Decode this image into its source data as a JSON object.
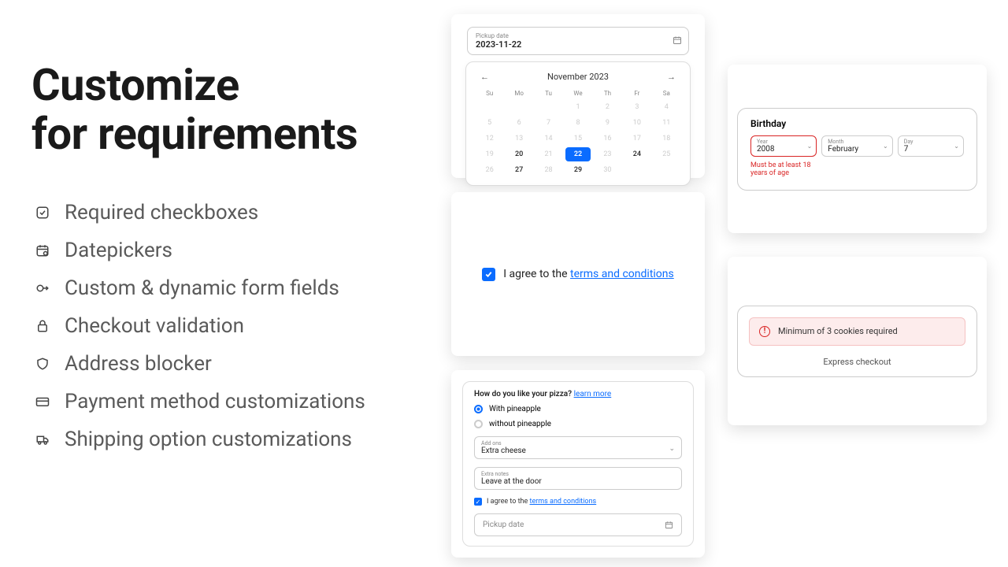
{
  "heading": {
    "line1": "Customize",
    "line2": "for requirements"
  },
  "features": [
    "Required checkboxes",
    "Datepickers",
    "Custom & dynamic form fields",
    "Checkout validation",
    "Address blocker",
    "Payment method customizations",
    "Shipping option customizations"
  ],
  "datepicker": {
    "label": "Pickup date",
    "value": "2023-11-22",
    "month_label": "November 2023",
    "dow": [
      "Su",
      "Mo",
      "Tu",
      "We",
      "Th",
      "Fr",
      "Sa"
    ],
    "days": [
      {
        "n": "",
        "s": "blank"
      },
      {
        "n": "",
        "s": "blank"
      },
      {
        "n": "",
        "s": "blank"
      },
      {
        "n": "1",
        "s": "dis"
      },
      {
        "n": "2",
        "s": "dis"
      },
      {
        "n": "3",
        "s": "dis"
      },
      {
        "n": "4",
        "s": "dis"
      },
      {
        "n": "5",
        "s": "dis"
      },
      {
        "n": "6",
        "s": "dis"
      },
      {
        "n": "7",
        "s": "dis"
      },
      {
        "n": "8",
        "s": "dis"
      },
      {
        "n": "9",
        "s": "dis"
      },
      {
        "n": "10",
        "s": "dis"
      },
      {
        "n": "11",
        "s": "dis"
      },
      {
        "n": "12",
        "s": "dis"
      },
      {
        "n": "13",
        "s": "dis"
      },
      {
        "n": "14",
        "s": "dis"
      },
      {
        "n": "15",
        "s": "dis"
      },
      {
        "n": "16",
        "s": "dis"
      },
      {
        "n": "17",
        "s": "dis"
      },
      {
        "n": "18",
        "s": "dis"
      },
      {
        "n": "19",
        "s": "dis"
      },
      {
        "n": "20",
        "s": "en"
      },
      {
        "n": "21",
        "s": "dis"
      },
      {
        "n": "22",
        "s": "sel"
      },
      {
        "n": "23",
        "s": "dis"
      },
      {
        "n": "24",
        "s": "en"
      },
      {
        "n": "25",
        "s": "dis"
      },
      {
        "n": "26",
        "s": "dis"
      },
      {
        "n": "27",
        "s": "en"
      },
      {
        "n": "28",
        "s": "dis"
      },
      {
        "n": "29",
        "s": "en"
      },
      {
        "n": "30",
        "s": "dis"
      }
    ]
  },
  "terms": {
    "text": "I agree to the ",
    "link": "terms and conditions"
  },
  "pizza": {
    "question": "How do you like your pizza? ",
    "learn_more": "learn more",
    "opt1": "With pineapple",
    "opt2": "without pineapple",
    "addons_label": "Add ons",
    "addons_value": "Extra cheese",
    "notes_label": "Extra notes",
    "notes_value": "Leave at the door",
    "agree_text": "I agree to the ",
    "agree_link": "terms and conditions",
    "pickup_placeholder": "Pickup date"
  },
  "birthday": {
    "title": "Birthday",
    "year_label": "Year",
    "year_value": "2008",
    "month_label": "Month",
    "month_value": "February",
    "day_label": "Day",
    "day_value": "7",
    "error": "Must be at least 18 years of age"
  },
  "cookies": {
    "alert_text": "Minimum of 3 cookies required",
    "express": "Express checkout"
  }
}
